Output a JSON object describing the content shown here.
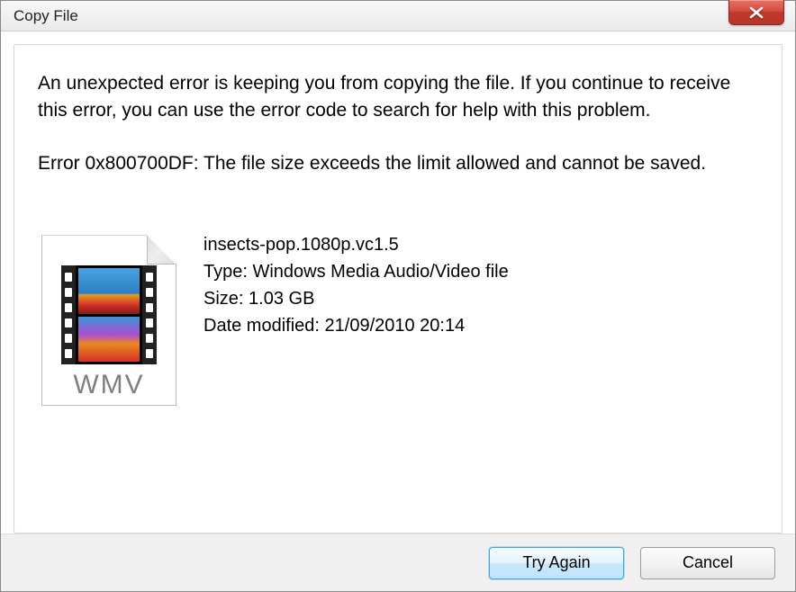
{
  "window": {
    "title": "Copy File"
  },
  "message": {
    "main": "An unexpected error is keeping you from copying the file. If you continue to receive this error, you can use the error code to search for help with this problem.",
    "error_line": "Error 0x800700DF: The file size exceeds the limit allowed and cannot be saved."
  },
  "file": {
    "name": "insects-pop.1080p.vc1.5",
    "type_label": "Type:",
    "type_value": "Windows Media Audio/Video file",
    "size_label": "Size:",
    "size_value": "1.03 GB",
    "modified_label": "Date modified:",
    "modified_value": "21/09/2010 20:14",
    "ext_label": "WMV"
  },
  "buttons": {
    "try_again": "Try Again",
    "cancel": "Cancel"
  }
}
